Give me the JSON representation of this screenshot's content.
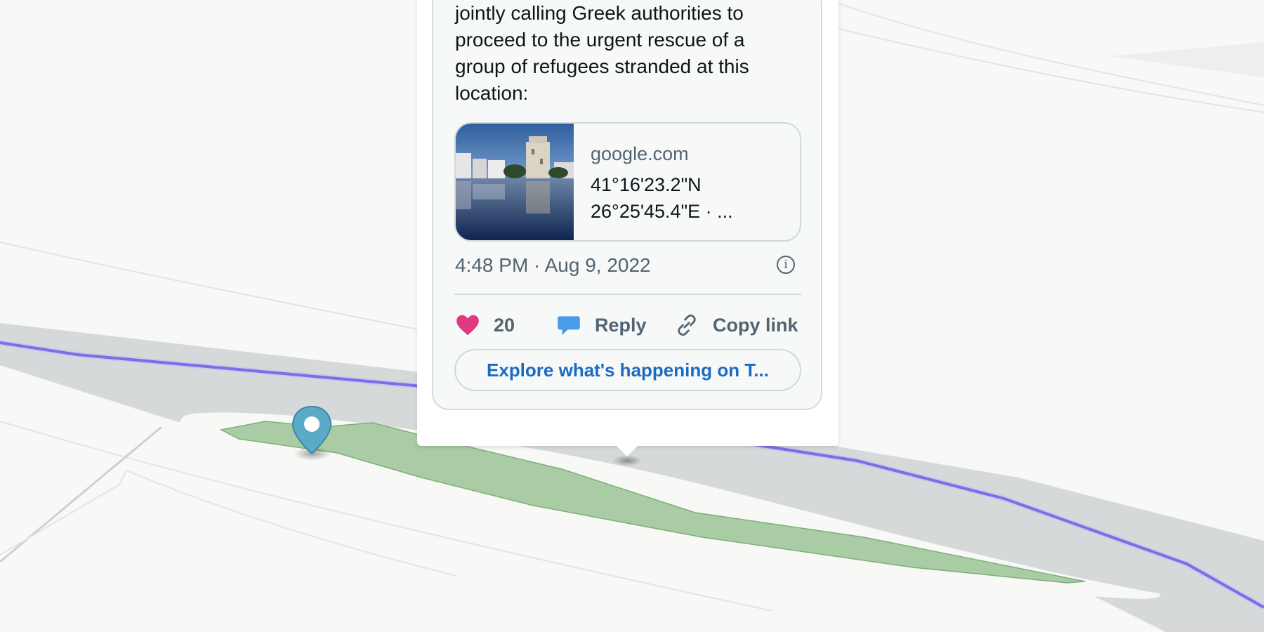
{
  "map": {
    "route_color": "#7b6ee6",
    "zone_color": "#a9cca4",
    "road_color": "#d6d9da",
    "background_color": "#f8f8f7"
  },
  "marker": {
    "icon": "map-pin-icon",
    "color": "#5aaac8"
  },
  "tweet": {
    "text": "jointly calling Greek authorities to proceed to the urgent rescue of a group of refugees stranded at this location:",
    "link_card": {
      "domain": "google.com",
      "title": "41°16'23.2\"N 26°25'45.4\"E · ..."
    },
    "timestamp": "4:48 PM · Aug 9, 2022",
    "info_icon": "info-icon",
    "actions": {
      "like_count": "20",
      "reply_label": "Reply",
      "copy_link_label": "Copy link"
    },
    "explore_label": "Explore what's happening on T..."
  }
}
